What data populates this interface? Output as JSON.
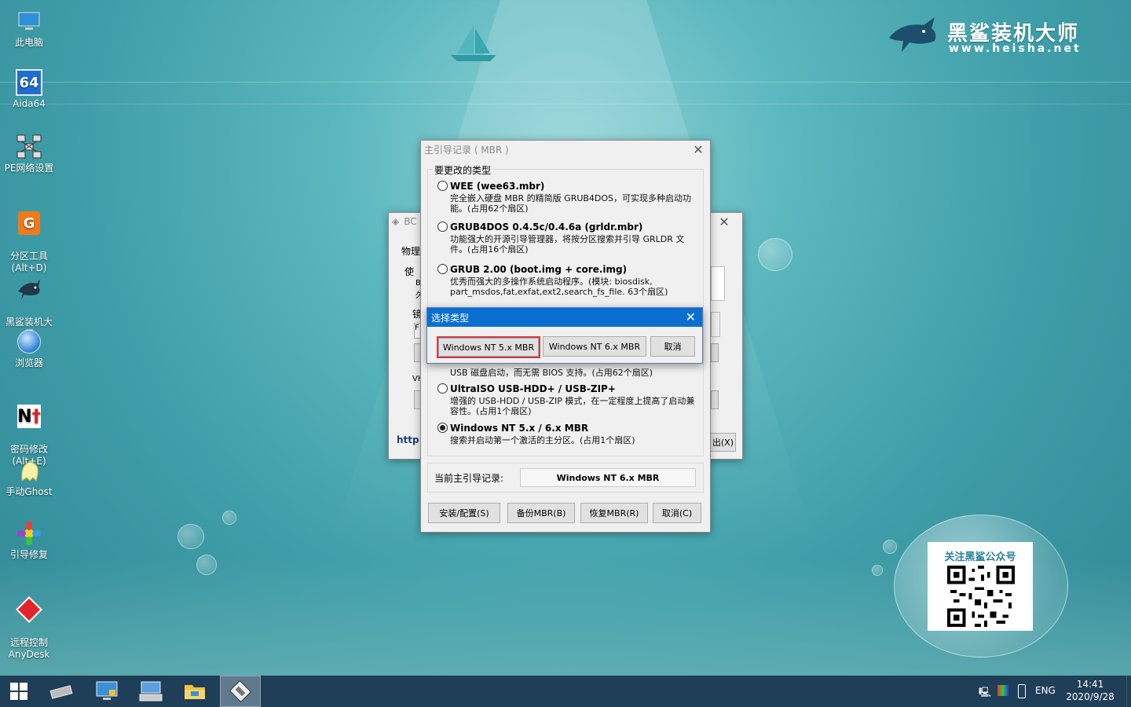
{
  "desktop_icons": [
    {
      "label": "此电脑",
      "icon": "computer-icon"
    },
    {
      "label": "Aida64",
      "icon": "aida64-icon",
      "glyph": "64"
    },
    {
      "label": "PE网络设置",
      "icon": "network-icon"
    },
    {
      "label": "分区工具\n(Alt+D)",
      "icon": "partition-tool-icon"
    },
    {
      "label": "黑鲨装机大\n师",
      "icon": "heisha-icon"
    },
    {
      "label": "浏览器",
      "icon": "browser-icon"
    },
    {
      "label": "密码修改\n(Alt+E)",
      "icon": "password-icon"
    },
    {
      "label": "手动Ghost",
      "icon": "ghost-icon"
    },
    {
      "label": "引导修复",
      "icon": "boot-repair-icon"
    },
    {
      "label": "远程控制\nAnyDesk",
      "icon": "anydesk-icon"
    }
  ],
  "logo": {
    "title": "黑鲨装机大师",
    "url": "www.heisha.net"
  },
  "qr_card": {
    "title": "关注黑鲨公众号"
  },
  "back_window": {
    "title_partial": "BC",
    "tab_partial": "物理",
    "label_a": "使",
    "label_b": "Bo",
    "label_c": "久",
    "label_d": "镜",
    "label_e": "F",
    "label_f": "VH",
    "link_partial": "http:",
    "btn_partial": "出(X)"
  },
  "mbr_window": {
    "title": "主引导记录 ( MBR )",
    "group_title": "要更改的类型",
    "options": [
      {
        "name": "WEE (wee63.mbr)",
        "desc": "完全嵌入硬盘 MBR 的精简版 GRUB4DOS，可实现多种启动功能。(占用62个扇区)",
        "selected": false
      },
      {
        "name": "GRUB4DOS 0.4.5c/0.4.6a (grldr.mbr)",
        "desc": "功能强大的开源引导管理器，将按分区搜索并引导 GRLDR 文件。(占用16个扇区)",
        "selected": false
      },
      {
        "name": "GRUB 2.00 (boot.img + core.img)",
        "desc": "优秀而强大的多操作系统启动程序。(模块: biosdisk, part_msdos,fat,exfat,ext2,search_fs_file. 63个扇区)",
        "selected": false
      },
      {
        "name": "",
        "desc": "USB 磁盘启动，而无需 BIOS 支持。(占用62个扇区)",
        "selected": false
      },
      {
        "name": "UltraISO USB-HDD+ / USB-ZIP+",
        "desc": "增强的 USB-HDD / USB-ZIP 模式，在一定程度上提高了启动兼容性。(占用1个扇区)",
        "selected": false
      },
      {
        "name": "Windows NT 5.x / 6.x MBR",
        "desc": "搜索并启动第一个激活的主分区。(占用1个扇区)",
        "selected": true
      }
    ],
    "current_label": "当前主引导记录:",
    "current_value": "Windows NT 6.x MBR",
    "buttons": {
      "install": "安装/配置(S)",
      "backup": "备份MBR(B)",
      "restore": "恢复MBR(R)",
      "cancel": "取消(C)"
    }
  },
  "select_dialog": {
    "title": "选择类型",
    "buttons": {
      "nt5": "Windows NT 5.x MBR",
      "nt6": "Windows NT 6.x MBR",
      "cancel": "取消"
    },
    "highlight_color": "#e03a30"
  },
  "taskbar": {
    "items": [
      "start-icon",
      "disk-tool-icon",
      "computer-manage-icon",
      "keyboard-icon",
      "folder-icon",
      "bootice-icon"
    ],
    "lang": "ENG",
    "time": "14:41",
    "date": "2020/9/28"
  }
}
